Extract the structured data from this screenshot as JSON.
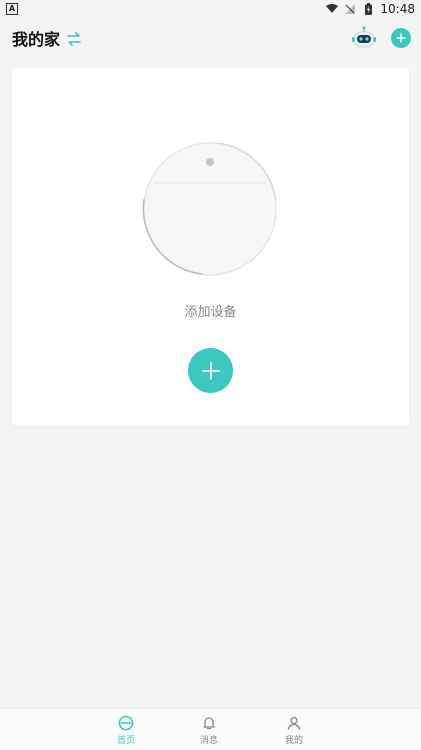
{
  "status_bar": {
    "app_indicator": "A",
    "time": "10:48"
  },
  "header": {
    "title": "我的家",
    "icons": [
      "swap-icon",
      "robot-assistant-icon",
      "add-icon"
    ]
  },
  "main": {
    "empty_state_text": "添加设备"
  },
  "bottom_nav": {
    "items": [
      {
        "label": "首页",
        "icon": "home-icon",
        "active": true
      },
      {
        "label": "消息",
        "icon": "bell-icon",
        "active": false
      },
      {
        "label": "我的",
        "icon": "user-icon",
        "active": false
      }
    ]
  },
  "colors": {
    "accent": "#3cc7c1",
    "background": "#f4f4f4",
    "card": "#ffffff",
    "muted_text": "#8a8a8a"
  }
}
